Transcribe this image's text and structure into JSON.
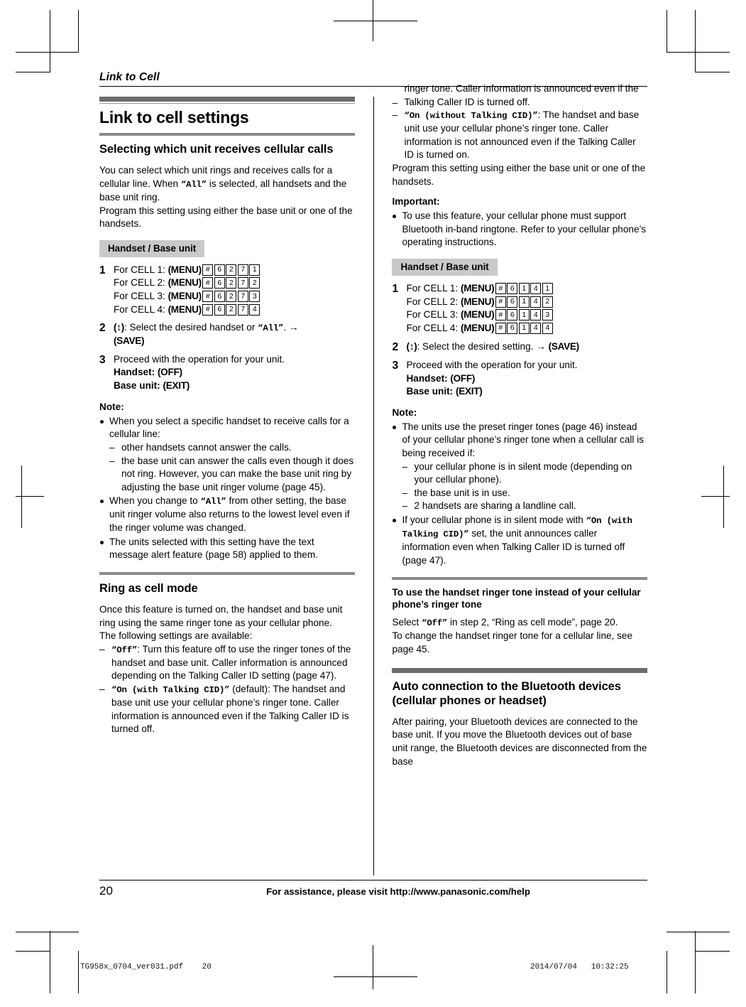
{
  "running_head": "Link to Cell",
  "main_heading": "Link to cell settings",
  "sections": {
    "selecting": {
      "heading": "Selecting which unit receives cellular calls",
      "intro_1_a": "You can select which unit rings and receives calls for a cellular line. When ",
      "intro_1_mono": "“All”",
      "intro_1_b": " is selected, all handsets and the base unit ring.",
      "intro_2": "Program this setting using either the base unit or one of the handsets.",
      "unit_tag": "Handset / Base unit",
      "steps": [
        {
          "num": "1",
          "lines": [
            {
              "label": "For CELL 1: ",
              "key": "(MENU)",
              "boxes": [
                "#",
                "6",
                "2",
                "7",
                "1"
              ]
            },
            {
              "label": "For CELL 2: ",
              "key": "(MENU)",
              "boxes": [
                "#",
                "6",
                "2",
                "7",
                "2"
              ]
            },
            {
              "label": "For CELL 3: ",
              "key": "(MENU)",
              "boxes": [
                "#",
                "6",
                "2",
                "7",
                "3"
              ]
            },
            {
              "label": "For CELL 4: ",
              "key": "(MENU)",
              "boxes": [
                "#",
                "6",
                "2",
                "7",
                "4"
              ]
            }
          ]
        },
        {
          "num": "2",
          "text_a": ": Select the desired handset or ",
          "mono": "“All”",
          "text_b": ". ",
          "arrow": "→",
          "save_key": "(SAVE)"
        },
        {
          "num": "3",
          "text": "Proceed with the operation for your unit.",
          "handset_label": "Handset: ",
          "handset_key": "(OFF)",
          "base_label": "Base unit: ",
          "base_key": "(EXIT)"
        }
      ],
      "note_label": "Note:",
      "notes": [
        {
          "text": "When you select a specific handset to receive calls for a cellular line:",
          "subitems": [
            "other handsets cannot answer the calls.",
            "the base unit can answer the calls even though it does not ring. However, you can make the base unit ring by adjusting the base unit ringer volume (page 45)."
          ]
        },
        {
          "text_a": "When you change to ",
          "mono": "“All”",
          "text_b": " from other setting, the base unit ringer volume also returns to the lowest level even if the ringer volume was changed."
        },
        {
          "text": "The units selected with this setting have the text message alert feature (page 58) applied to them."
        }
      ]
    },
    "ring_as_cell": {
      "heading": "Ring as cell mode",
      "intro_1": "Once this feature is turned on, the handset and base unit ring using the same ringer tone as your cellular phone.",
      "intro_2": "The following settings are available:",
      "options": [
        {
          "mono": "“Off”",
          "text": ": Turn this feature off to use the ringer tones of the handset and base unit. Caller information is announced depending on the Talking Caller ID setting (page 47)."
        },
        {
          "mono": "“On (with Talking CID)”",
          "text": " (default): The handset and base unit use your cellular phone’s ringer tone. Caller information is announced even if the Talking Caller ID is turned off."
        },
        {
          "mono": "“On (without Talking CID)”",
          "text": ": The handset and base unit use your cellular phone’s ringer tone. Caller information is not announced even if the Talking Caller ID is turned on."
        }
      ],
      "program_note": "Program this setting using either the base unit or one of the handsets.",
      "important_label": "Important:",
      "important_bullet": "To use this feature, your cellular phone must support Bluetooth in-band ringtone. Refer to your cellular phone’s operating instructions.",
      "unit_tag": "Handset / Base unit",
      "steps": [
        {
          "num": "1",
          "lines": [
            {
              "label": "For CELL 1: ",
              "key": "(MENU)",
              "boxes": [
                "#",
                "6",
                "1",
                "4",
                "1"
              ]
            },
            {
              "label": "For CELL 2: ",
              "key": "(MENU)",
              "boxes": [
                "#",
                "6",
                "1",
                "4",
                "2"
              ]
            },
            {
              "label": "For CELL 3: ",
              "key": "(MENU)",
              "boxes": [
                "#",
                "6",
                "1",
                "4",
                "3"
              ]
            },
            {
              "label": "For CELL 4: ",
              "key": "(MENU)",
              "boxes": [
                "#",
                "6",
                "1",
                "4",
                "4"
              ]
            }
          ]
        },
        {
          "num": "2",
          "text_a": ": Select the desired setting. ",
          "arrow": "→",
          "save_key": "(SAVE)"
        },
        {
          "num": "3",
          "text": "Proceed with the operation for your unit.",
          "handset_label": "Handset: ",
          "handset_key": "(OFF)",
          "base_label": "Base unit: ",
          "base_key": "(EXIT)"
        }
      ],
      "note_label": "Note:",
      "notes": [
        {
          "text": "The units use the preset ringer tones (page 46) instead of your cellular phone’s ringer tone when a cellular call is being received if:",
          "subitems": [
            "your cellular phone is in silent mode (depending on your cellular phone).",
            "the base unit is in use.",
            "2 handsets are sharing a landline call."
          ]
        },
        {
          "text_a": "If your cellular phone is in silent mode with ",
          "mono": "“On (with Talking CID)”",
          "text_b": " set, the unit announces caller information even when Talking Caller ID is turned off (page 47)."
        }
      ]
    },
    "handset_ringer": {
      "heading": "To use the handset ringer tone instead of your cellular phone’s ringer tone",
      "text_a": "Select ",
      "mono": "“Off”",
      "text_b": " in step 2, “Ring as cell mode”, page 20.",
      "text_c": "To change the handset ringer tone for a cellular line, see page 45."
    },
    "auto_connection": {
      "heading": "Auto connection to the Bluetooth devices (cellular phones or headset)",
      "text": "After pairing, your Bluetooth devices are connected to the base unit. If you move the Bluetooth devices out of base unit range, the Bluetooth devices are disconnected from the base"
    }
  },
  "footer": {
    "page_number": "20",
    "assistance_text": "For assistance, please visit http://www.panasonic.com/help"
  },
  "metadata": {
    "file": "TG958x_0704_ver031.pdf    20",
    "timestamp": "2014/07/04   10:32:25"
  },
  "navkey_glyph": "↕"
}
